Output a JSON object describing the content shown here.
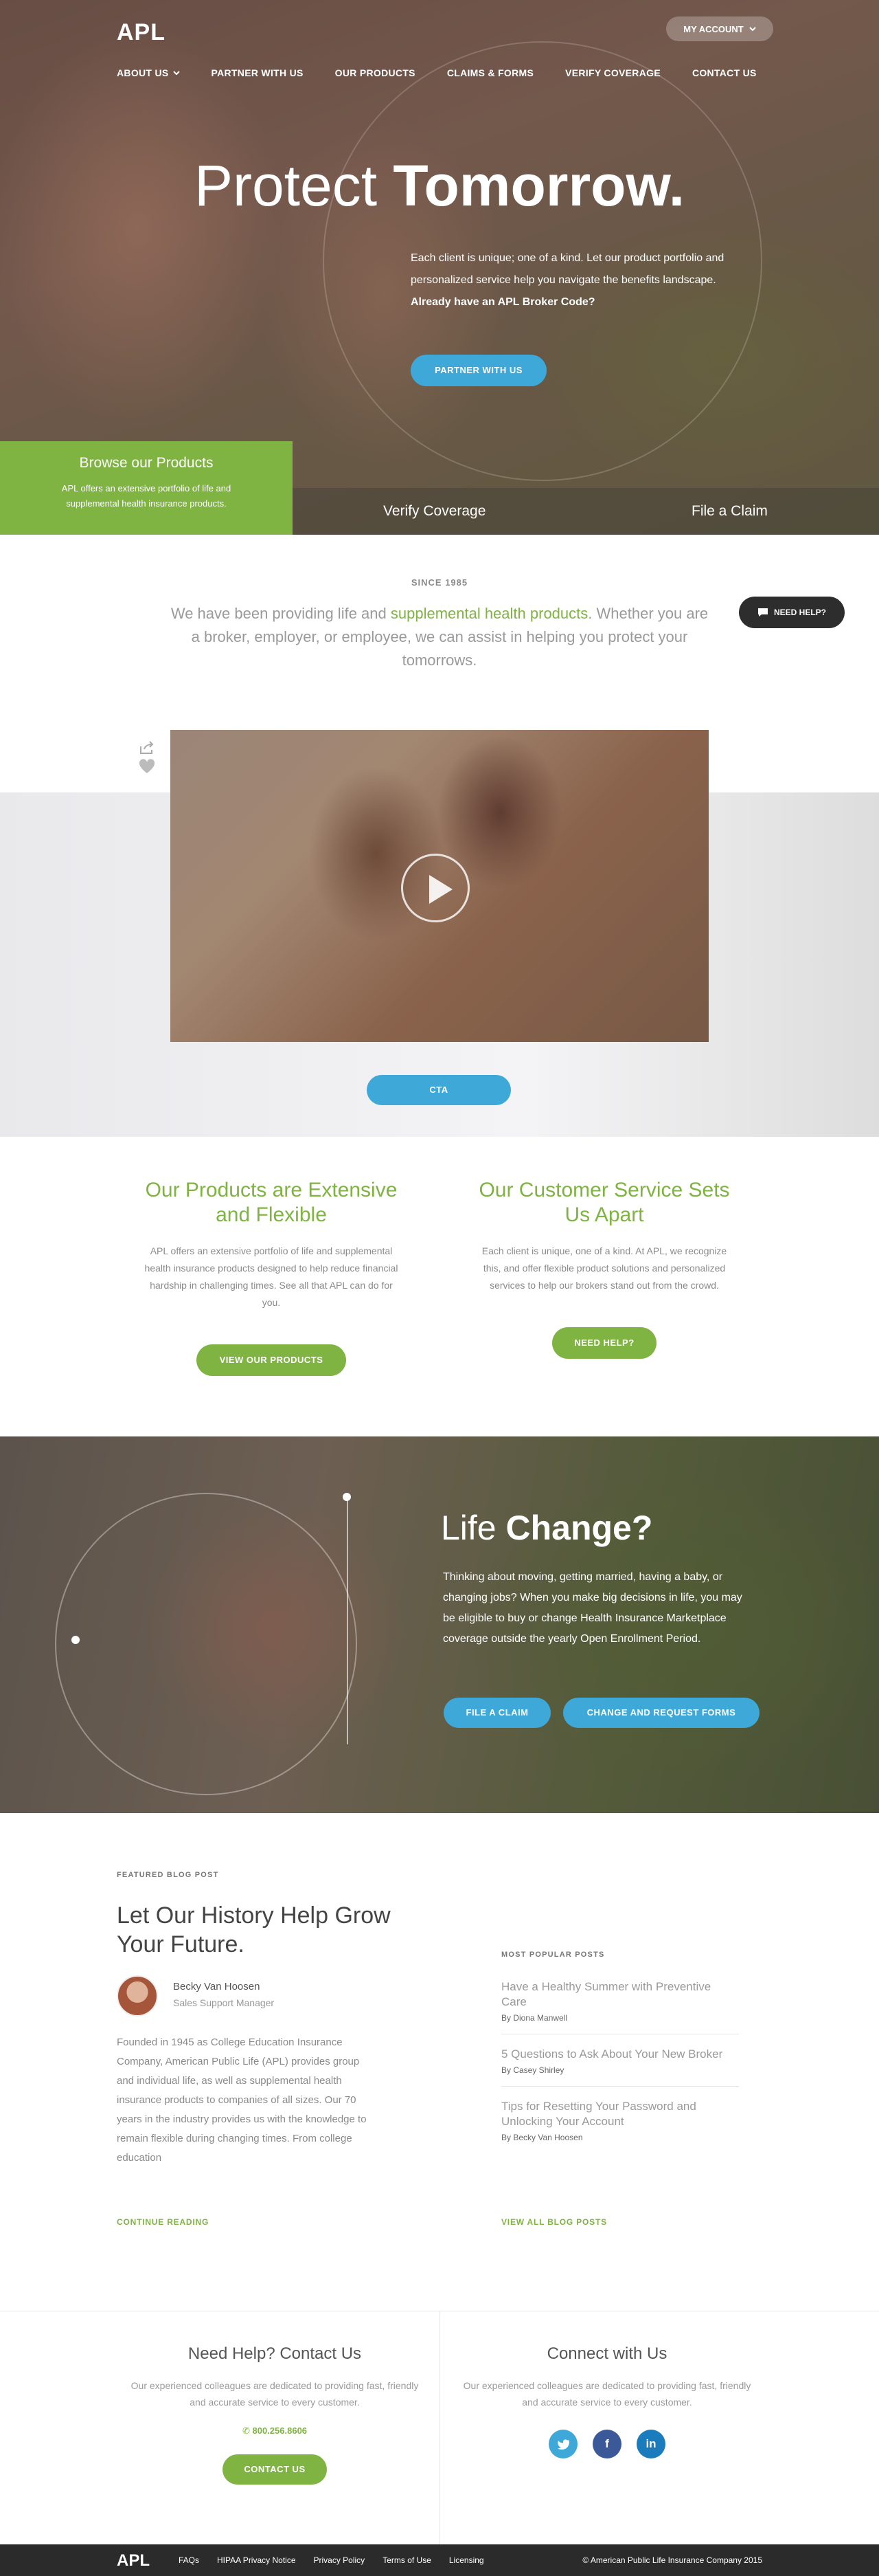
{
  "header": {
    "logo": "APL",
    "my_account": "MY ACCOUNT",
    "nav": [
      "ABOUT US",
      "PARTNER WITH US",
      "OUR PRODUCTS",
      "CLAIMS & FORMS",
      "VERIFY COVERAGE",
      "CONTACT US"
    ]
  },
  "hero": {
    "title_light": "Protect ",
    "title_bold": "Tomorrow.",
    "copy": "Each client is unique; one of a kind. Let our product portfolio and personalized service help you navigate the benefits landscape. ",
    "copy_bold": "Already have an APL Broker Code?",
    "cta": "PARTNER WITH US",
    "browse_title": "Browse our Products",
    "browse_copy": "APL offers an extensive portfolio of life and supplemental health insurance products.",
    "verify": "Verify Coverage",
    "claim": "File a Claim"
  },
  "since": {
    "label": "SINCE 1985",
    "pre": "We have been providing life and ",
    "highlight": "supplemental health products",
    "post": ". Whether you are a broker, employer, or employee, we can assist in helping you protect your tomorrows.",
    "need_help": "NEED HELP?"
  },
  "video": {
    "cta": "CTA"
  },
  "features": [
    {
      "title": "Our Products are Extensive and Flexible",
      "copy": "APL offers an extensive portfolio of life and supplemental health insurance products designed to help reduce financial hardship in challenging times. See all that APL can do for you.",
      "button": "VIEW OUR PRODUCTS"
    },
    {
      "title": "Our Customer Service Sets Us Apart",
      "copy": "Each client is unique, one of a kind. At APL, we recognize this, and offer flexible product solutions and personalized services to help our brokers stand out from the crowd.",
      "button": "NEED HELP?"
    }
  ],
  "life": {
    "title_light": "Life ",
    "title_bold": "Change?",
    "copy": "Thinking about moving, getting married, having a baby, or changing jobs? When you make big decisions in life, you may be eligible to buy or change Health Insurance Marketplace coverage outside the yearly Open Enrollment Period.",
    "btn1": "FILE A CLAIM",
    "btn2": "CHANGE AND REQUEST FORMS"
  },
  "blog": {
    "kicker": "FEATURED BLOG POST",
    "title": "Let Our History Help Grow Your Future.",
    "author": "Becky Van Hoosen",
    "role": "Sales Support Manager",
    "excerpt": "Founded in 1945 as College Education Insurance Company, American Public Life (APL) provides group and individual life, as well as supplemental health insurance products to companies of all sizes. Our 70 years in the industry provides us with the knowledge to remain flexible during changing times. From college education",
    "continue": "CONTINUE READING",
    "popular_label": "MOST POPULAR POSTS",
    "posts": [
      {
        "title": "Have a Healthy Summer with Preventive Care",
        "author": "By Diona Manwell"
      },
      {
        "title": "5 Questions to Ask About Your New Broker",
        "author": "By Casey Shirley"
      },
      {
        "title": "Tips for Resetting Your Password and Unlocking Your Account",
        "author": "By Becky Van Hoosen"
      }
    ],
    "view_all": "VIEW ALL BLOG POSTS"
  },
  "contact": {
    "help_title": "Need Help? Contact Us",
    "help_copy": "Our experienced colleagues are dedicated to providing fast, friendly and accurate service to every customer.",
    "phone": "800.256.8606",
    "button": "CONTACT US",
    "connect_title": "Connect with Us",
    "connect_copy": "Our experienced colleagues are dedicated to providing fast, friendly and accurate service to every customer.",
    "social": [
      "twitter-icon",
      "facebook-icon",
      "linkedin-icon"
    ]
  },
  "footer": {
    "logo": "APL",
    "links": [
      "FAQs",
      "HIPAA Privacy Notice",
      "Privacy Policy",
      "Terms of Use",
      "Licensing"
    ],
    "copyright": "© American Public Life Insurance Company 2015"
  },
  "colors": {
    "green": "#7fb342",
    "blue": "#3ea8d8",
    "dark": "#2b2b2b"
  }
}
